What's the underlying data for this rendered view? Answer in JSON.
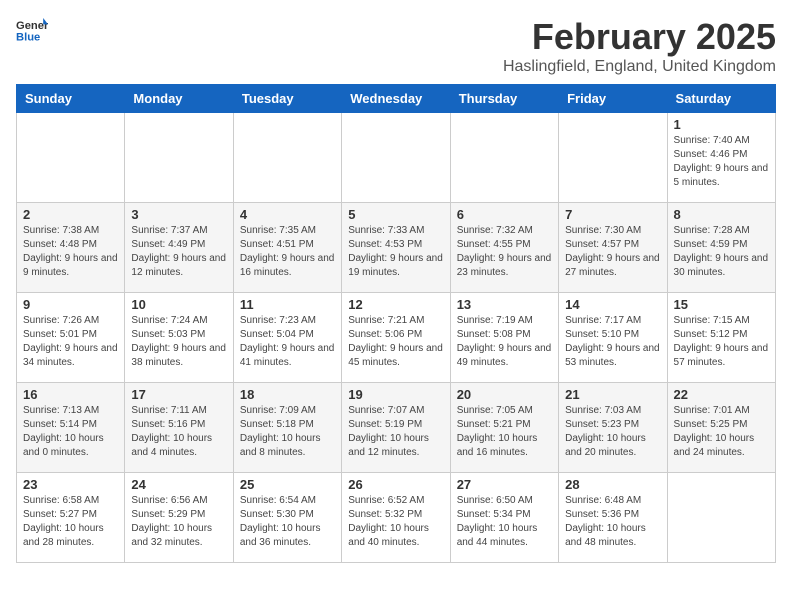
{
  "logo": {
    "text_general": "General",
    "text_blue": "Blue"
  },
  "title": "February 2025",
  "subtitle": "Haslingfield, England, United Kingdom",
  "weekdays": [
    "Sunday",
    "Monday",
    "Tuesday",
    "Wednesday",
    "Thursday",
    "Friday",
    "Saturday"
  ],
  "weeks": [
    [
      {
        "day": "",
        "info": ""
      },
      {
        "day": "",
        "info": ""
      },
      {
        "day": "",
        "info": ""
      },
      {
        "day": "",
        "info": ""
      },
      {
        "day": "",
        "info": ""
      },
      {
        "day": "",
        "info": ""
      },
      {
        "day": "1",
        "info": "Sunrise: 7:40 AM\nSunset: 4:46 PM\nDaylight: 9 hours and 5 minutes."
      }
    ],
    [
      {
        "day": "2",
        "info": "Sunrise: 7:38 AM\nSunset: 4:48 PM\nDaylight: 9 hours and 9 minutes."
      },
      {
        "day": "3",
        "info": "Sunrise: 7:37 AM\nSunset: 4:49 PM\nDaylight: 9 hours and 12 minutes."
      },
      {
        "day": "4",
        "info": "Sunrise: 7:35 AM\nSunset: 4:51 PM\nDaylight: 9 hours and 16 minutes."
      },
      {
        "day": "5",
        "info": "Sunrise: 7:33 AM\nSunset: 4:53 PM\nDaylight: 9 hours and 19 minutes."
      },
      {
        "day": "6",
        "info": "Sunrise: 7:32 AM\nSunset: 4:55 PM\nDaylight: 9 hours and 23 minutes."
      },
      {
        "day": "7",
        "info": "Sunrise: 7:30 AM\nSunset: 4:57 PM\nDaylight: 9 hours and 27 minutes."
      },
      {
        "day": "8",
        "info": "Sunrise: 7:28 AM\nSunset: 4:59 PM\nDaylight: 9 hours and 30 minutes."
      }
    ],
    [
      {
        "day": "9",
        "info": "Sunrise: 7:26 AM\nSunset: 5:01 PM\nDaylight: 9 hours and 34 minutes."
      },
      {
        "day": "10",
        "info": "Sunrise: 7:24 AM\nSunset: 5:03 PM\nDaylight: 9 hours and 38 minutes."
      },
      {
        "day": "11",
        "info": "Sunrise: 7:23 AM\nSunset: 5:04 PM\nDaylight: 9 hours and 41 minutes."
      },
      {
        "day": "12",
        "info": "Sunrise: 7:21 AM\nSunset: 5:06 PM\nDaylight: 9 hours and 45 minutes."
      },
      {
        "day": "13",
        "info": "Sunrise: 7:19 AM\nSunset: 5:08 PM\nDaylight: 9 hours and 49 minutes."
      },
      {
        "day": "14",
        "info": "Sunrise: 7:17 AM\nSunset: 5:10 PM\nDaylight: 9 hours and 53 minutes."
      },
      {
        "day": "15",
        "info": "Sunrise: 7:15 AM\nSunset: 5:12 PM\nDaylight: 9 hours and 57 minutes."
      }
    ],
    [
      {
        "day": "16",
        "info": "Sunrise: 7:13 AM\nSunset: 5:14 PM\nDaylight: 10 hours and 0 minutes."
      },
      {
        "day": "17",
        "info": "Sunrise: 7:11 AM\nSunset: 5:16 PM\nDaylight: 10 hours and 4 minutes."
      },
      {
        "day": "18",
        "info": "Sunrise: 7:09 AM\nSunset: 5:18 PM\nDaylight: 10 hours and 8 minutes."
      },
      {
        "day": "19",
        "info": "Sunrise: 7:07 AM\nSunset: 5:19 PM\nDaylight: 10 hours and 12 minutes."
      },
      {
        "day": "20",
        "info": "Sunrise: 7:05 AM\nSunset: 5:21 PM\nDaylight: 10 hours and 16 minutes."
      },
      {
        "day": "21",
        "info": "Sunrise: 7:03 AM\nSunset: 5:23 PM\nDaylight: 10 hours and 20 minutes."
      },
      {
        "day": "22",
        "info": "Sunrise: 7:01 AM\nSunset: 5:25 PM\nDaylight: 10 hours and 24 minutes."
      }
    ],
    [
      {
        "day": "23",
        "info": "Sunrise: 6:58 AM\nSunset: 5:27 PM\nDaylight: 10 hours and 28 minutes."
      },
      {
        "day": "24",
        "info": "Sunrise: 6:56 AM\nSunset: 5:29 PM\nDaylight: 10 hours and 32 minutes."
      },
      {
        "day": "25",
        "info": "Sunrise: 6:54 AM\nSunset: 5:30 PM\nDaylight: 10 hours and 36 minutes."
      },
      {
        "day": "26",
        "info": "Sunrise: 6:52 AM\nSunset: 5:32 PM\nDaylight: 10 hours and 40 minutes."
      },
      {
        "day": "27",
        "info": "Sunrise: 6:50 AM\nSunset: 5:34 PM\nDaylight: 10 hours and 44 minutes."
      },
      {
        "day": "28",
        "info": "Sunrise: 6:48 AM\nSunset: 5:36 PM\nDaylight: 10 hours and 48 minutes."
      },
      {
        "day": "",
        "info": ""
      }
    ]
  ]
}
